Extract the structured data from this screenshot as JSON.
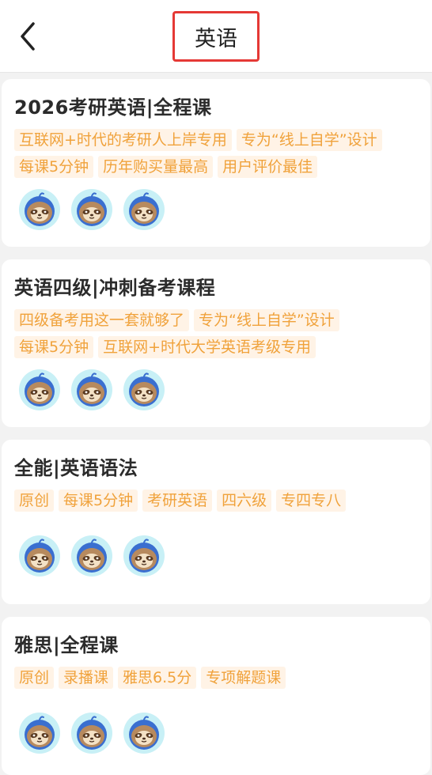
{
  "header": {
    "title": "英语",
    "back_icon": "chevron-left-icon"
  },
  "accent_colors": {
    "tag_text": "#f0a23b",
    "tag_bg": "#fff3e6",
    "title_highlight_border": "#e53935"
  },
  "courses": [
    {
      "title": "2026考研英语|全程课",
      "tags": [
        "互联网+时代的考研人上岸专用",
        "专为“线上自学”设计",
        "每课5分钟",
        "历年购买量最高",
        "用户评价最佳"
      ],
      "avatars": [
        "sloth-mascot-icon",
        "sloth-mascot-icon",
        "sloth-mascot-icon"
      ]
    },
    {
      "title": "英语四级|冲刺备考课程",
      "tags": [
        "四级备考用这一套就够了",
        "专为“线上自学”设计",
        "每课5分钟",
        "互联网+时代大学英语考级专用"
      ],
      "avatars": [
        "sloth-mascot-icon",
        "sloth-mascot-icon",
        "sloth-mascot-icon"
      ]
    },
    {
      "title": "全能|英语语法",
      "tags": [
        "原创",
        "每课5分钟",
        "考研英语",
        "四六级",
        "专四专八"
      ],
      "avatars": [
        "sloth-mascot-icon",
        "sloth-mascot-icon",
        "sloth-mascot-icon"
      ]
    },
    {
      "title": "雅思|全程课",
      "tags": [
        "原创",
        "录播课",
        "雅思6.5分",
        "专项解题课"
      ],
      "avatars": [
        "sloth-mascot-icon",
        "sloth-mascot-icon",
        "sloth-mascot-icon"
      ]
    }
  ]
}
